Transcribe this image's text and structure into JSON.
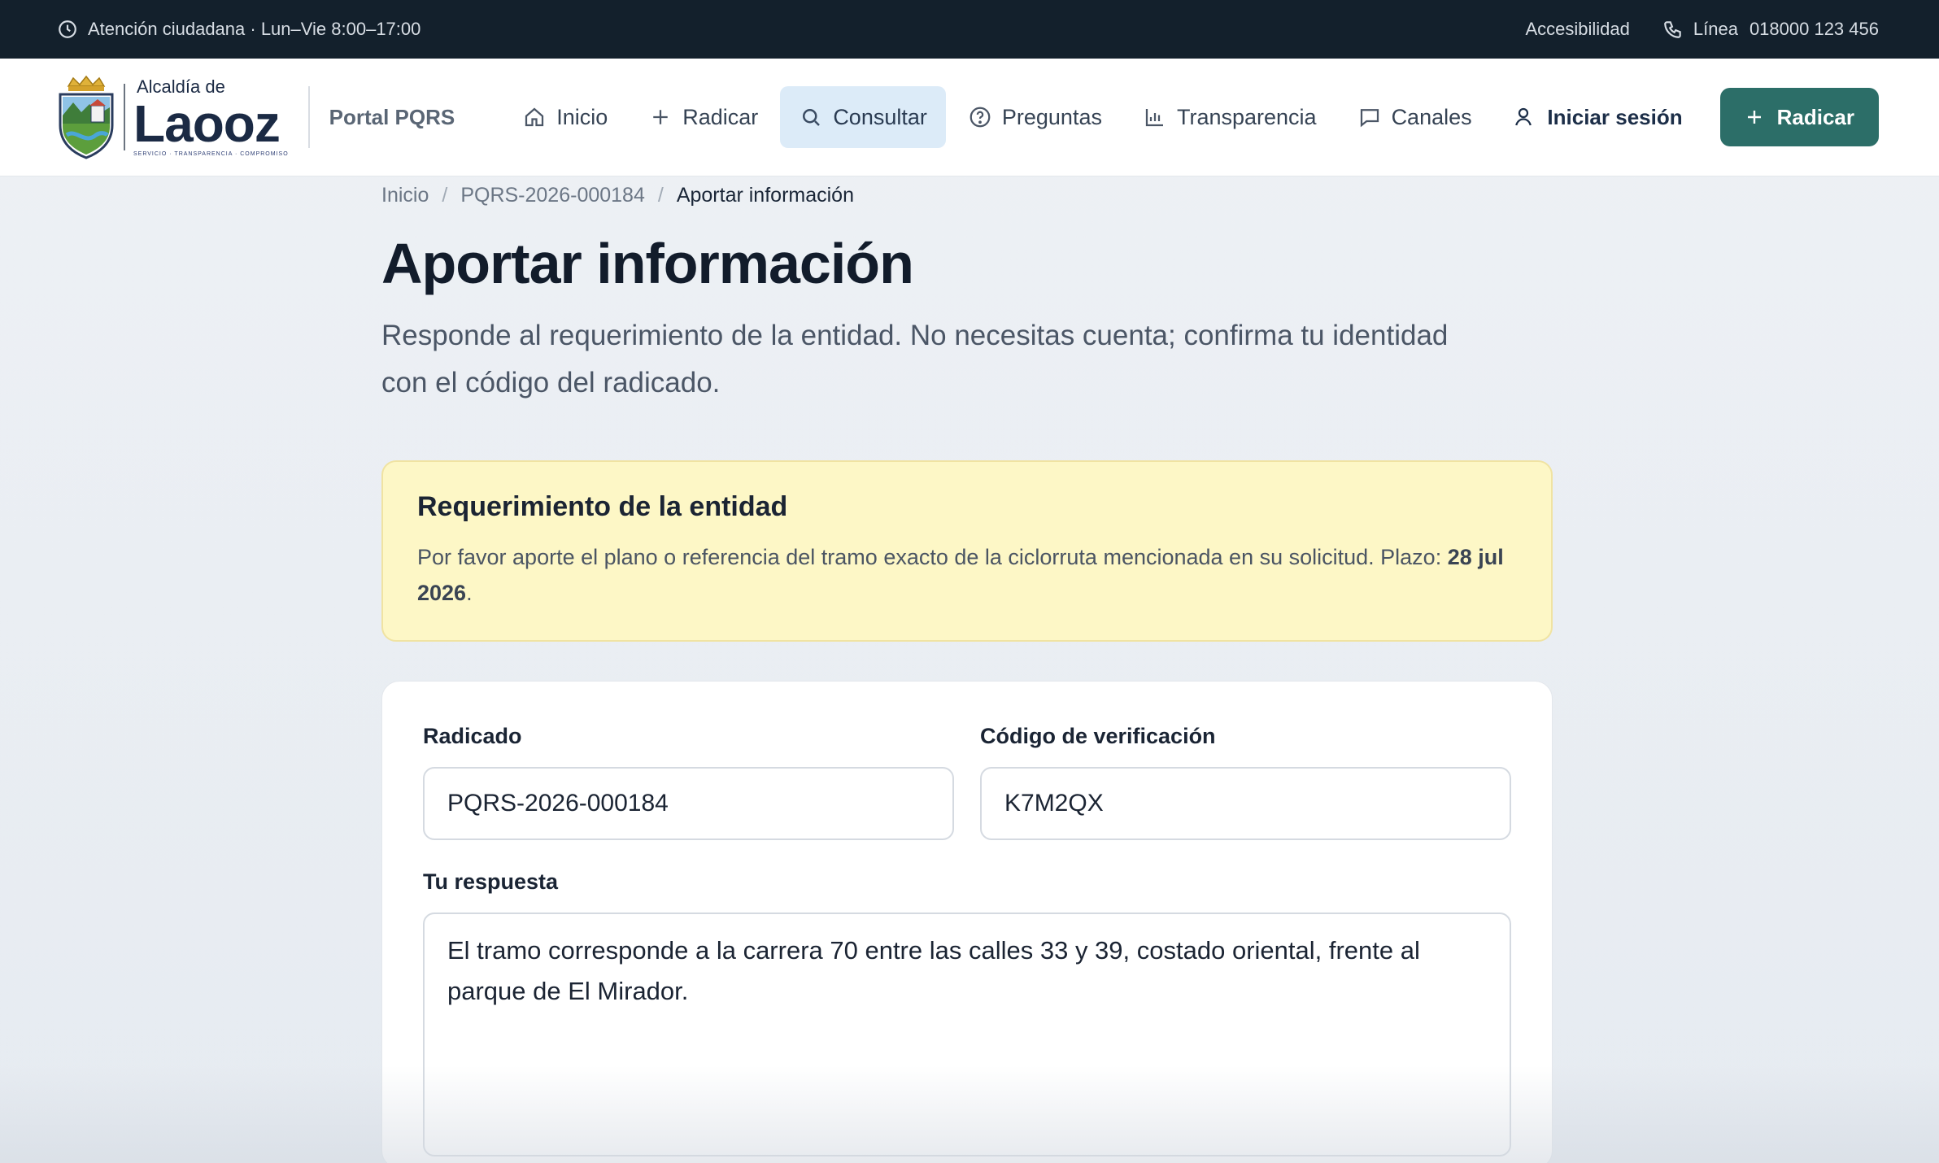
{
  "topbar": {
    "hours": "Atención ciudadana · Lun–Vie 8:00–17:00",
    "accessibility": "Accesibilidad",
    "phone_label": "Línea",
    "phone_number": "018000 123 456"
  },
  "header": {
    "brand_pre": "Alcaldía de",
    "brand_name": "Laooz",
    "brand_tagline": "SERVICIO · TRANSPARENCIA · COMPROMISO",
    "portal": "Portal PQRS",
    "nav": [
      {
        "label": "Inicio",
        "icon": "home-icon"
      },
      {
        "label": "Radicar",
        "icon": "plus-icon"
      },
      {
        "label": "Consultar",
        "icon": "search-icon",
        "active": true
      },
      {
        "label": "Preguntas",
        "icon": "help-circle-icon"
      },
      {
        "label": "Transparencia",
        "icon": "bar-chart-icon"
      },
      {
        "label": "Canales",
        "icon": "chat-icon"
      }
    ],
    "login": "Iniciar sesión",
    "cta": "Radicar"
  },
  "breadcrumb": [
    "Inicio",
    "PQRS-2026-000184",
    "Aportar información"
  ],
  "page": {
    "title": "Aportar información",
    "lead": "Responde al requerimiento de la entidad. No necesitas cuenta; confirma tu identidad con el código del radicado."
  },
  "notice": {
    "title": "Requerimiento de la entidad",
    "body": "Por favor aporte el plano o referencia del tramo exacto de la ciclorruta mencionada en su solicitud. Plazo: ",
    "deadline": "28 jul 2026",
    "end": "."
  },
  "form": {
    "radicado_label": "Radicado",
    "radicado_value": "PQRS-2026-000184",
    "code_label": "Código de verificación",
    "code_value": "K7M2QX",
    "response_label": "Tu respuesta",
    "response_value": "El tramo corresponde a la carrera 70 entre las calles 33 y 39, costado oriental, frente al parque de El Mirador."
  },
  "colors": {
    "topbar": "#13202c",
    "accent": "#2c6e68",
    "active_nav": "#dcebf8",
    "notice_bg": "#fdf7c6"
  }
}
